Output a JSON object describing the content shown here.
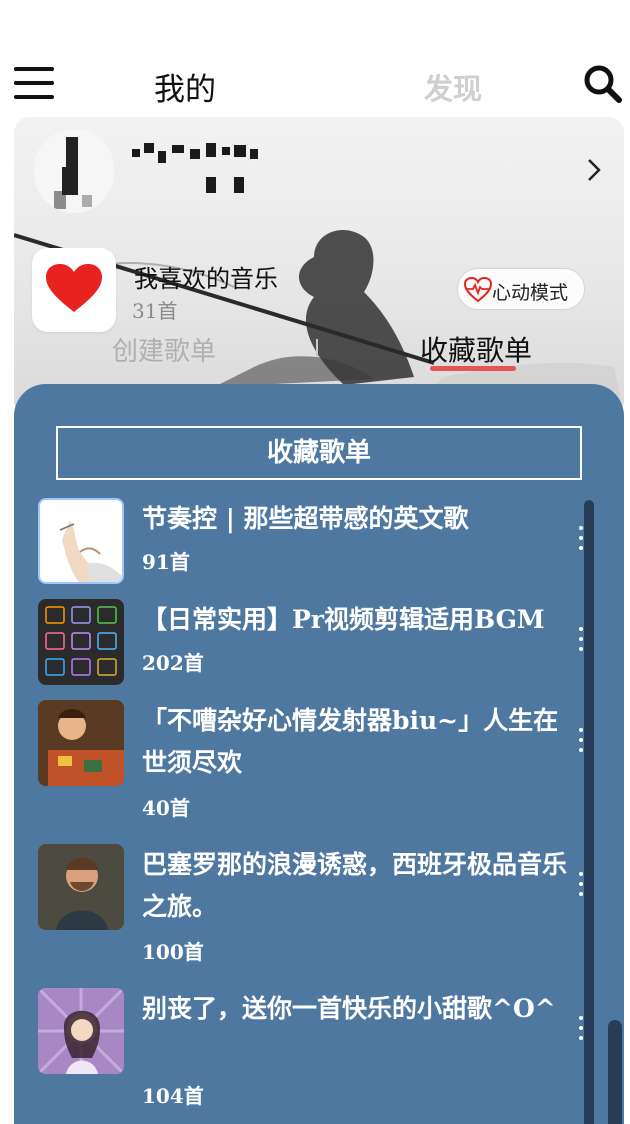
{
  "header": {
    "tab_mine": "我的",
    "tab_discover": "发现"
  },
  "icons": {
    "menu": "hamburger-menu-icon",
    "search": "search-icon",
    "chevron": "chevron-right-icon",
    "heart": "heart-icon",
    "heartbeat": "heartbeat-icon",
    "more": "more-vertical-icon"
  },
  "profile": {
    "favorites_title": "我喜欢的音乐",
    "favorites_count": "31首",
    "heartbeat_mode": "心动模式"
  },
  "subtabs": {
    "created": "创建歌单",
    "collected": "收藏歌单"
  },
  "panel": {
    "title": "收藏歌单",
    "playlists": [
      {
        "title": "节奏控 | 那些超带感的英文歌",
        "count": "91首"
      },
      {
        "title": "【日常实用】Pr视频剪辑适用BGM",
        "count": "202首"
      },
      {
        "title": "「不嘈杂好心情发射器biu~」人生在世须尽欢",
        "count": "40首"
      },
      {
        "title": "巴塞罗那的浪漫诱惑，西班牙极品音乐之旅。",
        "count": "100首"
      },
      {
        "title": "别丧了，送你一首快乐的小甜歌^O^",
        "count": "104首"
      }
    ]
  },
  "colors": {
    "panel_bg": "#4f78a1",
    "accent_red": "#e45454",
    "heart_red": "#e8231f",
    "scrollbar": "#273d57"
  }
}
